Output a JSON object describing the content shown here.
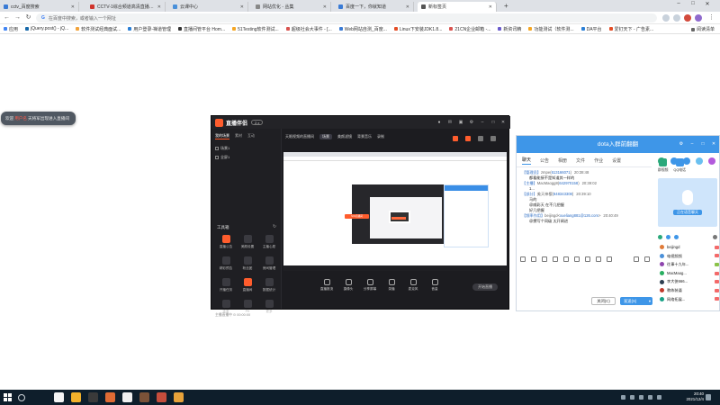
{
  "browser": {
    "tabs": [
      {
        "label": "cctv_百度搜索",
        "color": "#3a7bd5"
      },
      {
        "label": "CCTV-1综合频道高清直播_CCTV节目官网",
        "color": "#d0342c"
      },
      {
        "label": "云课中心",
        "color": "#4a90d9"
      },
      {
        "label": "网站优化 - 丛集",
        "color": "#888888"
      },
      {
        "label": "百度一下，你就知道",
        "color": "#3a7bd5"
      },
      {
        "label": "新标签页",
        "color": "#555555",
        "active": true
      }
    ],
    "new_tab": "+",
    "window_buttons": [
      "–",
      "□",
      "✕"
    ],
    "address_placeholder": "在百度中搜索，或者输入一个网址",
    "bookmarks": [
      {
        "label": "应用",
        "color": "#4285f4"
      },
      {
        "label": "jQuery.post() - jQ...",
        "color": "#1769aa"
      },
      {
        "label": "软件测试经典面试...",
        "color": "#f2a33a"
      },
      {
        "label": "用户登录-禅道管理",
        "color": "#2b7fd6"
      },
      {
        "label": "直播间管平台 Hom...",
        "color": "#333333"
      },
      {
        "label": "51Testing软件测试...",
        "color": "#f5a623"
      },
      {
        "label": "超级社会大事件 - [...",
        "color": "#d9534f"
      },
      {
        "label": "Web网站自测_百度...",
        "color": "#3a7bd5"
      },
      {
        "label": "Linux下安装JDK1.8...",
        "color": "#e44d26"
      },
      {
        "label": "21CN企业邮箱 -...",
        "color": "#d9534f"
      },
      {
        "label": "新资讯精",
        "color": "#6a5acd"
      },
      {
        "label": "功能测试（软件测...",
        "color": "#f5a623"
      },
      {
        "label": "DA平台",
        "color": "#2b7fd6"
      },
      {
        "label": "爱钉天下 - 广告素...",
        "color": "#e44d26"
      }
    ],
    "reading_list": "阅读清单"
  },
  "notice": {
    "prefix": "欢迎",
    "highlight": "用户名",
    "suffix": "天将军出现进入直播间"
  },
  "live_app": {
    "brand": "直播伴侣",
    "version": "2.x",
    "side_tabs": [
      "我的场景",
      "素材",
      "互动"
    ],
    "scenes": [
      "场景1",
      "全屏1"
    ],
    "tools_title": "工具箱",
    "tools": [
      {
        "label": "直播公告",
        "hot": true
      },
      {
        "label": "美颜设置",
        "hot": false
      },
      {
        "label": "主播心愿",
        "hot": false
      },
      {
        "label": "精彩预告",
        "hot": false
      },
      {
        "label": "粉丝团",
        "hot": false
      },
      {
        "label": "房间管理",
        "hot": false
      },
      {
        "label": "开播任务",
        "hot": false
      },
      {
        "label": "直播间",
        "hot": true
      },
      {
        "label": "数据统计",
        "hot": false
      },
      {
        "label": "连麦",
        "hot": false
      },
      {
        "label": "PK",
        "hot": false
      },
      {
        "label": "更多",
        "hot": false
      }
    ],
    "bottom_text": "主播直播中 ⊙ 00:00:00",
    "scene_header": [
      "天眼视频的直播间",
      "场景",
      "美颜滤镜",
      "背景音乐",
      "录制"
    ],
    "preview_label": "SYA直播间",
    "controls": [
      "直播推流",
      "摄像头",
      "分享屏幕",
      "录播",
      "麦克风",
      "音量"
    ],
    "go_live": "开始直播"
  },
  "chat": {
    "title": "dota入群前翻翻",
    "tabs": [
      "聊天",
      "公告",
      "相册",
      "文件",
      "作业",
      "设置"
    ],
    "messages": [
      {
        "role": "【管理员】",
        "name": "zmpe(",
        "id": "613166071",
        "suffix": ")",
        "time": "20:38:48",
        "body": "都看能接不是知道其一样的"
      },
      {
        "role": "【主播】",
        "name": "MacMaogg8(",
        "id": "642970158",
        "suffix": ")",
        "time": "20:39:02",
        "body": "1..."
      },
      {
        "role": "【部分】",
        "name": "美天神樱(",
        "id": "848343308",
        "suffix": ")",
        "time": "20:39:10",
        "body": "马的"
      },
      {
        "role": "",
        "name": "",
        "id": "",
        "suffix": "",
        "time": "",
        "body": "@威彩天 在不几把握"
      },
      {
        "role": "",
        "name": "",
        "id": "",
        "suffix": "",
        "time": "",
        "body": "好几把握"
      },
      {
        "role": "【频率作用】",
        "name": "beijingd<",
        "id": "xueliang881@126.com",
        "suffix": ">",
        "time": "20:40:49",
        "body": "@撰写个同级 太开闸进"
      }
    ],
    "close_label": "关闭(C)",
    "send_label": "发送(S)",
    "send_arrow": "▾",
    "right_tabs": [
      "群视频",
      "QQ电话"
    ],
    "voice_label": "正在语音聊天",
    "members": [
      {
        "name": "beijingd",
        "color": "#e07b39",
        "tag": "red"
      },
      {
        "name": "电视频频",
        "color": "#4a90d9",
        "tag": "red"
      },
      {
        "name": "往事十九年...",
        "color": "#8e44ad",
        "tag": "green"
      },
      {
        "name": "MacMaog...",
        "color": "#27ae60",
        "tag": "red"
      },
      {
        "name": "李大侠666...",
        "color": "#2c3e50",
        "tag": "red"
      },
      {
        "name": "教练装逼",
        "color": "#c0392b",
        "tag": "red"
      },
      {
        "name": "网络拓展...",
        "color": "#16a085",
        "tag": "red"
      }
    ]
  },
  "taskbar": {
    "time": "20:40",
    "date": "2021/12/4",
    "apps": [
      {
        "color": "#f4f4f4"
      },
      {
        "color": "#f2b12b"
      },
      {
        "color": "#3a3a3a"
      },
      {
        "color": "#e06b34"
      },
      {
        "color": "#f0f0f0"
      },
      {
        "color": "#7a5238"
      },
      {
        "color": "#c54d3c"
      },
      {
        "color": "#e7a23a"
      }
    ]
  }
}
